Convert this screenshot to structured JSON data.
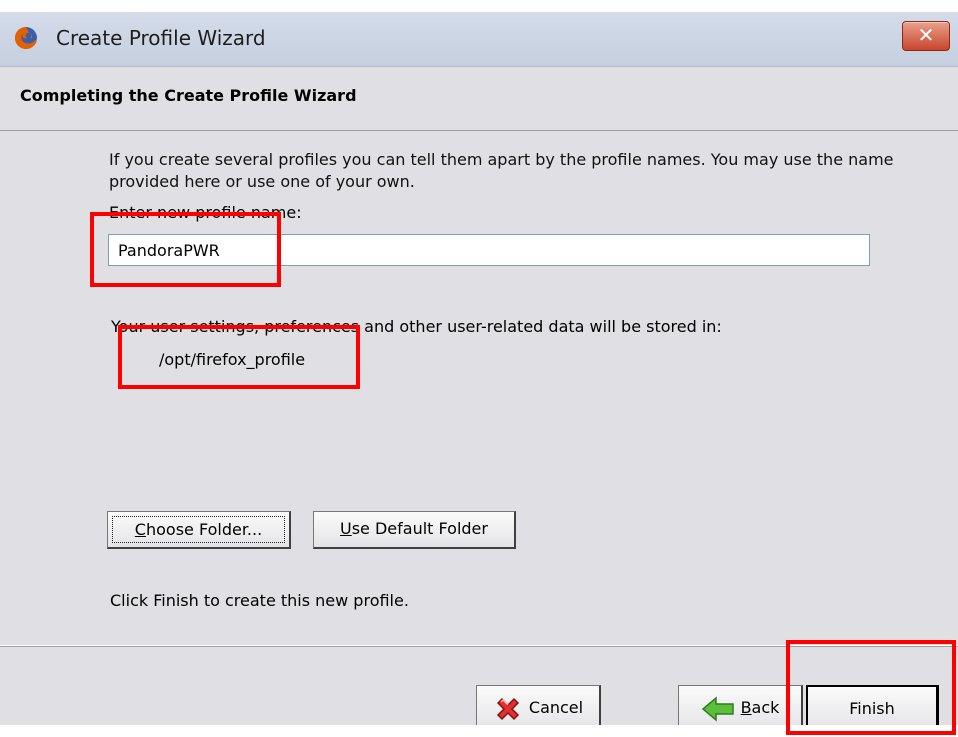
{
  "window": {
    "title": "Create Profile Wizard",
    "close_label": "✕"
  },
  "header": {
    "title": "Completing the Create Profile Wizard"
  },
  "content": {
    "description": "If you create several profiles you can tell them apart by the profile names. You may use the name provided here or use one of your own.",
    "name_label": "Enter new profile name:",
    "profile_name_value": "PandoraPWR",
    "storage_label": "Your user settings, preferences and other user-related data will be stored in:",
    "storage_path": "/opt/firefox_profile",
    "choose_folder": {
      "accel": "C",
      "rest": "hoose Folder..."
    },
    "default_folder": {
      "accel": "U",
      "rest": "se Default Folder"
    },
    "finish_note": "Click Finish to create this new profile."
  },
  "footer": {
    "cancel_label": "Cancel",
    "back": {
      "accel": "B",
      "rest": "ack"
    },
    "finish_label": "Finish"
  },
  "colors": {
    "annotation_highlight": "#ff0000"
  }
}
